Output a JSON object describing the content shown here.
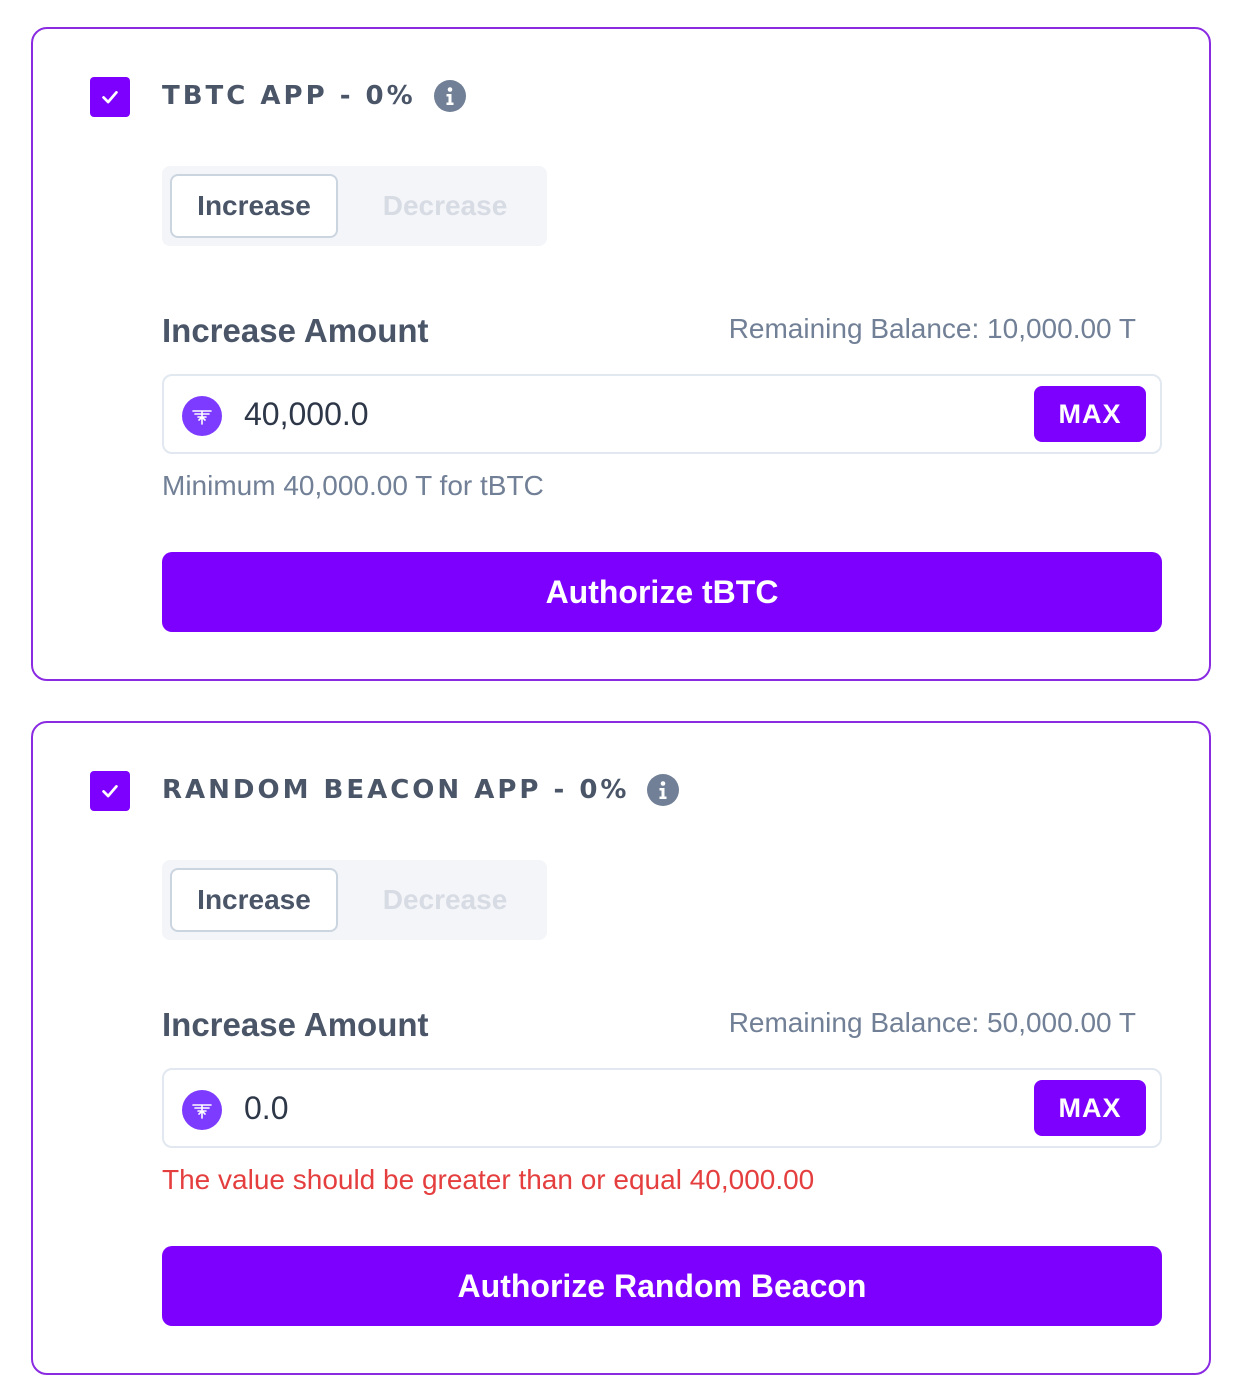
{
  "colors": {
    "accent": "#7d00ff",
    "card_border": "#8a2be2",
    "error": "#e53e3e",
    "muted_text": "#718096",
    "heading_text": "#4a5568"
  },
  "apps": [
    {
      "checked": true,
      "title": "TBTC APP - 0%",
      "info_icon": "info-icon",
      "toggle": {
        "increase": "Increase",
        "decrease": "Decrease",
        "selected": "Increase"
      },
      "amount_label": "Increase Amount",
      "remaining_balance": "Remaining Balance: 10,000.00 T",
      "token_icon": "threshold-token-icon",
      "amount_value": "40,000.0",
      "max_label": "MAX",
      "helper_text": "Minimum 40,000.00 T for tBTC",
      "helper_is_error": false,
      "authorize_label": "Authorize tBTC"
    },
    {
      "checked": true,
      "title": "RANDOM BEACON APP - 0%",
      "info_icon": "info-icon",
      "toggle": {
        "increase": "Increase",
        "decrease": "Decrease",
        "selected": "Increase"
      },
      "amount_label": "Increase Amount",
      "remaining_balance": "Remaining Balance: 50,000.00 T",
      "token_icon": "threshold-token-icon",
      "amount_value": "0.0",
      "max_label": "MAX",
      "helper_text": "The value should be greater than or equal 40,000.00",
      "helper_is_error": true,
      "authorize_label": "Authorize Random Beacon"
    }
  ]
}
